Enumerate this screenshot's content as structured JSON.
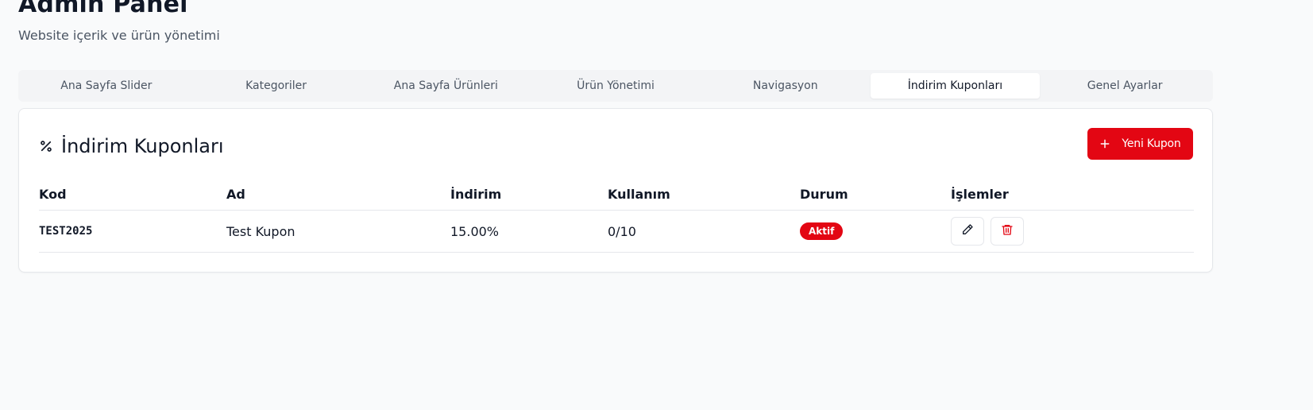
{
  "header": {
    "title": "Admin Panel",
    "subtitle": "Website içerik ve ürün yönetimi"
  },
  "tabs": [
    {
      "label": "Ana Sayfa Slider",
      "active": false
    },
    {
      "label": "Kategoriler",
      "active": false
    },
    {
      "label": "Ana Sayfa Ürünleri",
      "active": false
    },
    {
      "label": "Ürün Yönetimi",
      "active": false
    },
    {
      "label": "Navigasyon",
      "active": false
    },
    {
      "label": "İndirim Kuponları",
      "active": true
    },
    {
      "label": "Genel Ayarlar",
      "active": false
    }
  ],
  "coupons": {
    "title": "İndirim Kuponları",
    "title_icon": "percent-icon",
    "new_button_label": "Yeni Kupon",
    "new_button_icon": "plus-icon",
    "columns": [
      "Kod",
      "Ad",
      "İndirim",
      "Kullanım",
      "Durum",
      "İşlemler"
    ],
    "rows": [
      {
        "code": "TEST2025",
        "name": "Test Kupon",
        "discount": "15.00%",
        "usage": "0/10",
        "status": "Aktif",
        "actions": [
          "edit-icon",
          "trash-icon"
        ]
      }
    ]
  },
  "colors": {
    "accent": "#e30613",
    "background": "#f9fafb",
    "tab_bar": "#f3f4f6"
  }
}
